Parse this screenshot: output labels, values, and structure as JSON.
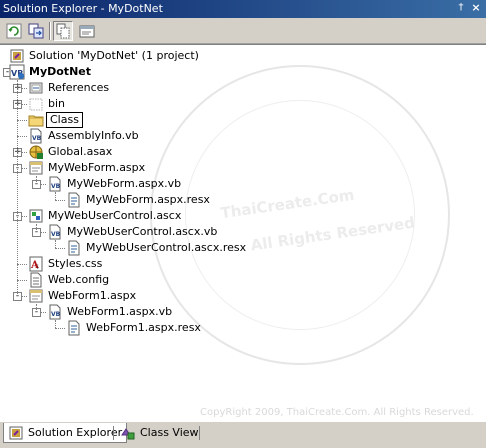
{
  "window": {
    "title": "Solution Explorer - MyDotNet",
    "pin_glyph": "†",
    "close_glyph": "×"
  },
  "toolbar": {
    "buttons": [
      {
        "name": "refresh-icon",
        "pressed": false
      },
      {
        "name": "copy-project-icon",
        "pressed": false
      },
      {
        "name": "show-all-files-icon",
        "pressed": true
      },
      {
        "name": "properties-icon",
        "pressed": false
      }
    ]
  },
  "tree": {
    "nodes": [
      {
        "label": "Solution 'MyDotNet' (1 project)",
        "icon": "solution-icon",
        "depth": 0,
        "expander": null
      },
      {
        "label": "MyDotNet",
        "icon": "vb-project-icon",
        "depth": 0,
        "expander": "-",
        "bold": true
      },
      {
        "label": "References",
        "icon": "references-icon",
        "depth": 1,
        "expander": "+"
      },
      {
        "label": "bin",
        "icon": "hidden-folder-icon",
        "depth": 1,
        "expander": "+"
      },
      {
        "label": "Class",
        "icon": "folder-icon",
        "depth": 1,
        "expander": null,
        "editing": true
      },
      {
        "label": "AssemblyInfo.vb",
        "icon": "vb-file-icon",
        "depth": 1,
        "expander": null
      },
      {
        "label": "Global.asax",
        "icon": "global-asax-icon",
        "depth": 1,
        "expander": "+"
      },
      {
        "label": "MyWebForm.aspx",
        "icon": "webform-icon",
        "depth": 1,
        "expander": "-"
      },
      {
        "label": "MyWebForm.aspx.vb",
        "icon": "vb-file-icon",
        "depth": 2,
        "expander": "-"
      },
      {
        "label": "MyWebForm.aspx.resx",
        "icon": "resx-icon",
        "depth": 3,
        "expander": null
      },
      {
        "label": "MyWebUserControl.ascx",
        "icon": "user-control-icon",
        "depth": 1,
        "expander": "-"
      },
      {
        "label": "MyWebUserControl.ascx.vb",
        "icon": "vb-file-icon",
        "depth": 2,
        "expander": "-"
      },
      {
        "label": "MyWebUserControl.ascx.resx",
        "icon": "resx-icon",
        "depth": 3,
        "expander": null
      },
      {
        "label": "Styles.css",
        "icon": "css-icon",
        "depth": 1,
        "expander": null
      },
      {
        "label": "Web.config",
        "icon": "config-icon",
        "depth": 1,
        "expander": null
      },
      {
        "label": "WebForm1.aspx",
        "icon": "webform-icon",
        "depth": 1,
        "expander": "-"
      },
      {
        "label": "WebForm1.aspx.vb",
        "icon": "vb-file-icon",
        "depth": 2,
        "expander": "-"
      },
      {
        "label": "WebForm1.aspx.resx",
        "icon": "resx-icon",
        "depth": 3,
        "expander": null
      }
    ]
  },
  "watermark": {
    "line1": "ThaiCreate.Com",
    "line2": "All Rights Reserved",
    "copyright": "CopyRight 2009, ThaiCreate.Com. All Rights Reserved."
  },
  "tabs": [
    {
      "label": "Solution Explorer",
      "icon": "solution-explorer-icon",
      "active": true
    },
    {
      "label": "Class View",
      "icon": "class-view-icon",
      "active": false
    }
  ]
}
